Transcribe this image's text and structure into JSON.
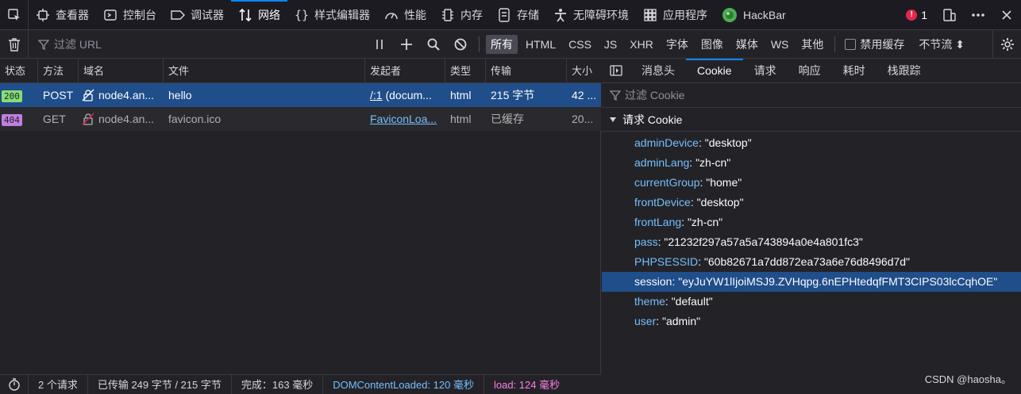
{
  "toolbar": {
    "tabs": [
      {
        "label": "查看器",
        "icon": "inspector-icon"
      },
      {
        "label": "控制台",
        "icon": "console-icon"
      },
      {
        "label": "调试器",
        "icon": "debugger-icon"
      },
      {
        "label": "网络",
        "icon": "network-icon"
      },
      {
        "label": "样式编辑器",
        "icon": "style-editor-icon"
      },
      {
        "label": "性能",
        "icon": "performance-icon"
      },
      {
        "label": "内存",
        "icon": "memory-icon"
      },
      {
        "label": "存储",
        "icon": "storage-icon"
      },
      {
        "label": "无障碍环境",
        "icon": "accessibility-icon"
      },
      {
        "label": "应用程序",
        "icon": "application-icon"
      },
      {
        "label": "HackBar",
        "icon": "hackbar-icon"
      }
    ],
    "active_tab": "网络",
    "error_count": "1"
  },
  "filterbar": {
    "filter_placeholder": "过滤 URL",
    "types": [
      "所有",
      "HTML",
      "CSS",
      "JS",
      "XHR",
      "字体",
      "图像",
      "媒体",
      "WS",
      "其他"
    ],
    "active_type": "所有",
    "disable_cache": "禁用缓存",
    "throttle": "不节流 ⬍"
  },
  "table": {
    "headers": [
      "状态",
      "方法",
      "域名",
      "文件",
      "发起者",
      "类型",
      "传输",
      "大小"
    ],
    "rows": [
      {
        "status": "200",
        "method": "POST",
        "domain": "node4.an...",
        "file": "hello",
        "initiator": "/:1",
        "initiator_extra": " (docum...",
        "type": "html",
        "transfer": "215 字节",
        "size": "42 ..."
      },
      {
        "status": "404",
        "method": "GET",
        "domain": "node4.an...",
        "file": "favicon.ico",
        "initiator": "FaviconLoa...",
        "initiator_extra": "",
        "type": "html",
        "transfer": "已缓存",
        "size": "20..."
      }
    ]
  },
  "statusbar": {
    "requests": "2 个请求",
    "transferred": "已传输 249 字节 / 215 字节",
    "finish": "完成：163 毫秒",
    "dom": "DOMContentLoaded: 120 毫秒",
    "load": "load: 124 毫秒"
  },
  "sidebar": {
    "tabs": [
      "消息头",
      "Cookie",
      "请求",
      "响应",
      "耗时",
      "栈跟踪"
    ],
    "active_tab": "Cookie",
    "filter_placeholder": "过滤 Cookie",
    "section_title": "请求 Cookie",
    "cookies": [
      {
        "key": "adminDevice",
        "value": "\"desktop\""
      },
      {
        "key": "adminLang",
        "value": "\"zh-cn\""
      },
      {
        "key": "currentGroup",
        "value": "\"home\""
      },
      {
        "key": "frontDevice",
        "value": "\"desktop\""
      },
      {
        "key": "frontLang",
        "value": "\"zh-cn\""
      },
      {
        "key": "pass",
        "value": "\"21232f297a57a5a743894a0e4a801fc3\""
      },
      {
        "key": "PHPSESSID",
        "value": "\"60b82671a7dd872ea73a6e76d8496d7d\""
      },
      {
        "key": "session",
        "value": "\"eyJuYW1lIjoiMSJ9.ZVHqpg.6nEPHtedqfFMT3CIPS03lcCqhOE\""
      },
      {
        "key": "theme",
        "value": "\"default\""
      },
      {
        "key": "user",
        "value": "\"admin\""
      }
    ],
    "selected_cookie": "session"
  },
  "watermark": "CSDN @haosha。",
  "colors": {
    "accent": "#0a84ff",
    "selection": "#204e8a",
    "status_ok": "#86de74",
    "status_404": "#bf7ee0",
    "error": "#e22850"
  }
}
